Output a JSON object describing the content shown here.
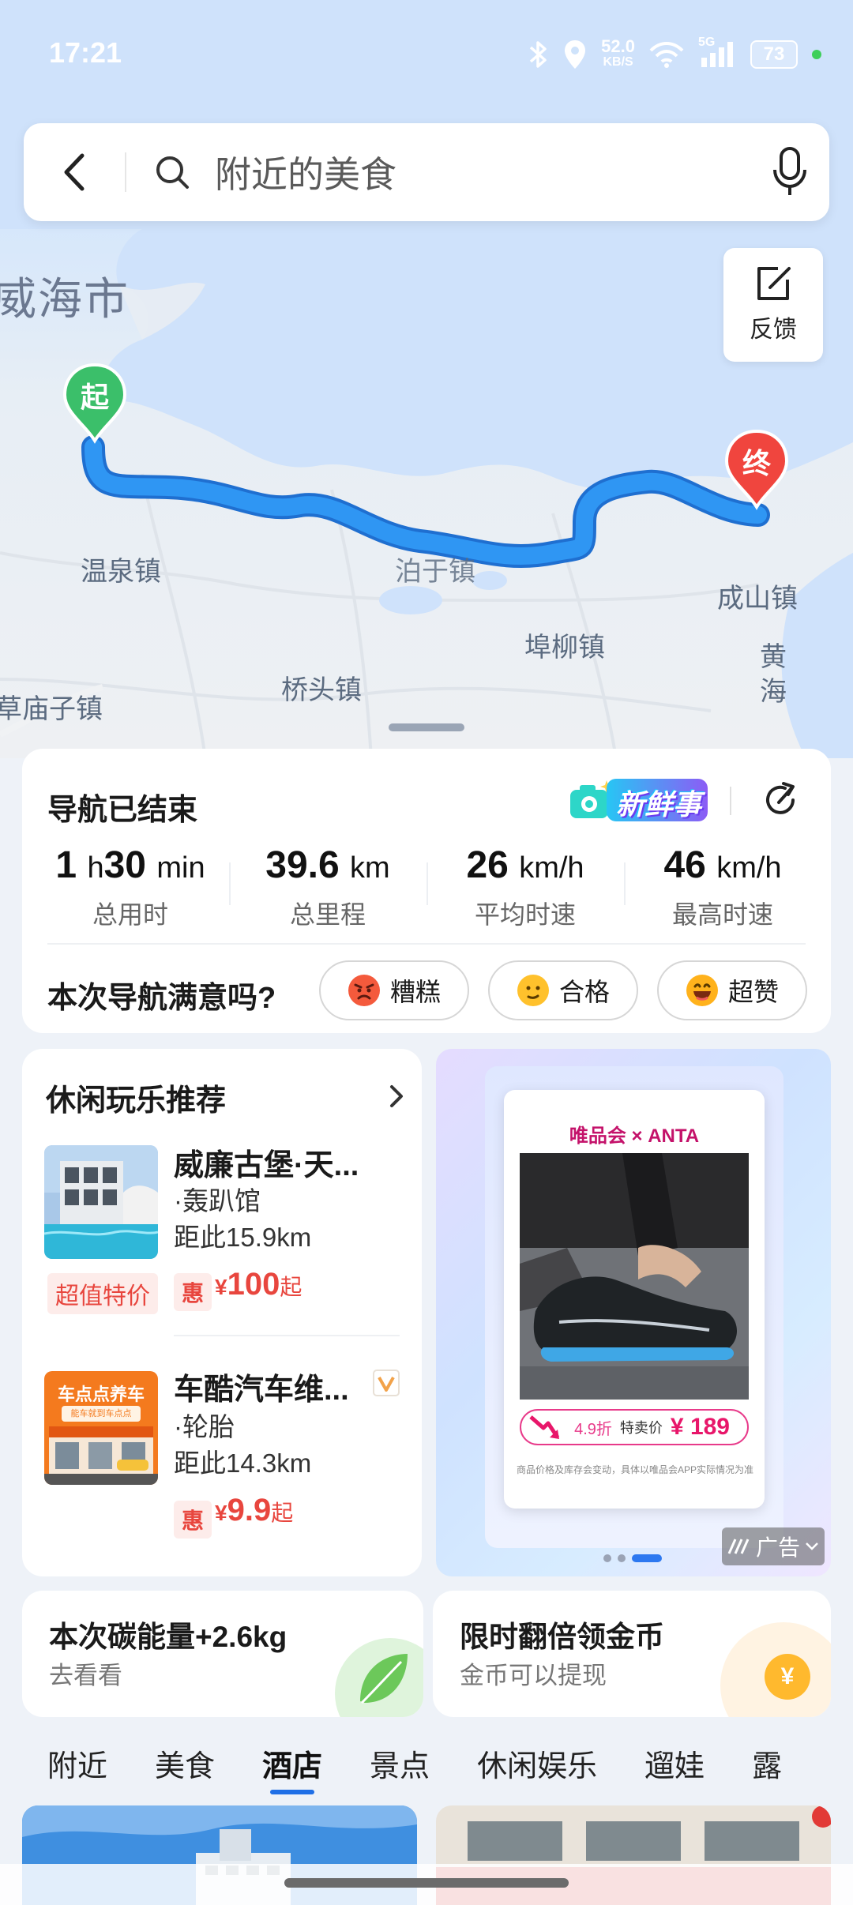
{
  "status_bar": {
    "time": "17:21",
    "network_speed_value": "52.0",
    "network_speed_unit": "KB/S",
    "signal_label": "5G",
    "battery": "73"
  },
  "search": {
    "placeholder": "附近的美食"
  },
  "feedback": {
    "label": "反馈"
  },
  "map": {
    "labels": [
      "威海市",
      "温泉镇",
      "泊于镇",
      "成山镇",
      "埠柳镇",
      "桥头镇",
      "草庙子镇",
      "黄",
      "海"
    ],
    "start_pin": "起",
    "end_pin": "终",
    "route_color": "#2b8ff0"
  },
  "navigation_summary": {
    "title": "导航已结束",
    "fresh_label": "新鲜事",
    "stats": [
      {
        "value": "1",
        "unit": "h",
        "value2": "30",
        "unit2": "min",
        "label": "总用时"
      },
      {
        "value": "39.6",
        "unit": "km",
        "label": "总里程"
      },
      {
        "value": "26",
        "unit": "km/h",
        "label": "平均时速"
      },
      {
        "value": "46",
        "unit": "km/h",
        "label": "最高时速"
      }
    ],
    "satisfaction_question": "本次导航满意吗?",
    "ratings": [
      "糟糕",
      "合格",
      "超赞"
    ]
  },
  "leisure": {
    "title": "休闲玩乐推荐",
    "items": [
      {
        "name": "威廉古堡·天...",
        "category": "·轰趴馆",
        "distance": "距此15.9km",
        "badge": "超值特价",
        "hui": "惠",
        "currency": "¥",
        "price": "100",
        "suffix": "起"
      },
      {
        "name": "车酷汽车维...",
        "category": "·轮胎",
        "distance": "距此14.3km",
        "hui": "惠",
        "currency": "¥",
        "price": "9.9",
        "suffix": "起",
        "image_text": "车点点养车",
        "image_subtext": "能车就到车点点"
      }
    ]
  },
  "ad": {
    "brand": "唯品会 × ANTA",
    "discount": "4.9折",
    "sale_label": "特卖价",
    "price": "¥ 189",
    "fine_print": "商品价格及库存会变动，具体以唯品会APP实际情况为准",
    "tag": "广告",
    "brand_color": "#c4126a"
  },
  "carbon": {
    "title": "本次碳能量+2.6kg",
    "subtitle": "去看看"
  },
  "coins": {
    "title": "限时翻倍领金币",
    "subtitle": "金币可以提现",
    "coin_symbol": "¥"
  },
  "category_tabs": [
    "附近",
    "美食",
    "酒店",
    "景点",
    "休闲娱乐",
    "遛娃",
    "露"
  ],
  "active_tab": "酒店",
  "accent_color": "#1f6fe6"
}
